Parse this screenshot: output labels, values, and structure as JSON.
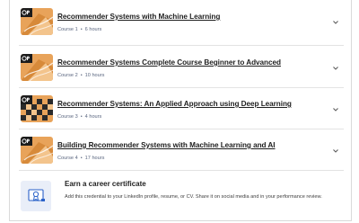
{
  "courses": [
    {
      "title": "Recommender Systems with Machine Learning",
      "course_num": "Course 1",
      "duration": "6 hours",
      "thumb": "orange"
    },
    {
      "title": "Recommender Systems Complete Course Beginner to Advanced",
      "course_num": "Course 2",
      "duration": "10 hours",
      "thumb": "orange"
    },
    {
      "title": "Recommender Systems: An Applied Approach using Deep Learning",
      "course_num": "Course 3",
      "duration": "4 hours",
      "thumb": "checker"
    },
    {
      "title": "Building Recommender Systems with Machine Learning and AI",
      "course_num": "Course 4",
      "duration": "17 hours",
      "thumb": "orange"
    }
  ],
  "separator": "•",
  "certificate": {
    "title": "Earn a career certificate",
    "description": "Add this credential to your LinkedIn profile, resume, or CV. Share it on social media and in your performance review."
  },
  "colors": {
    "accent_orange": "#e39a4e",
    "title_text": "#1f1f1f",
    "meta_text": "#5b6780",
    "cert_icon_bg": "#e9eef8",
    "cert_icon_stroke": "#2a62c9"
  },
  "icons": {
    "expand": "chevron-down-icon",
    "provider_logo": "provider-logo-icon",
    "certificate": "certificate-icon"
  }
}
